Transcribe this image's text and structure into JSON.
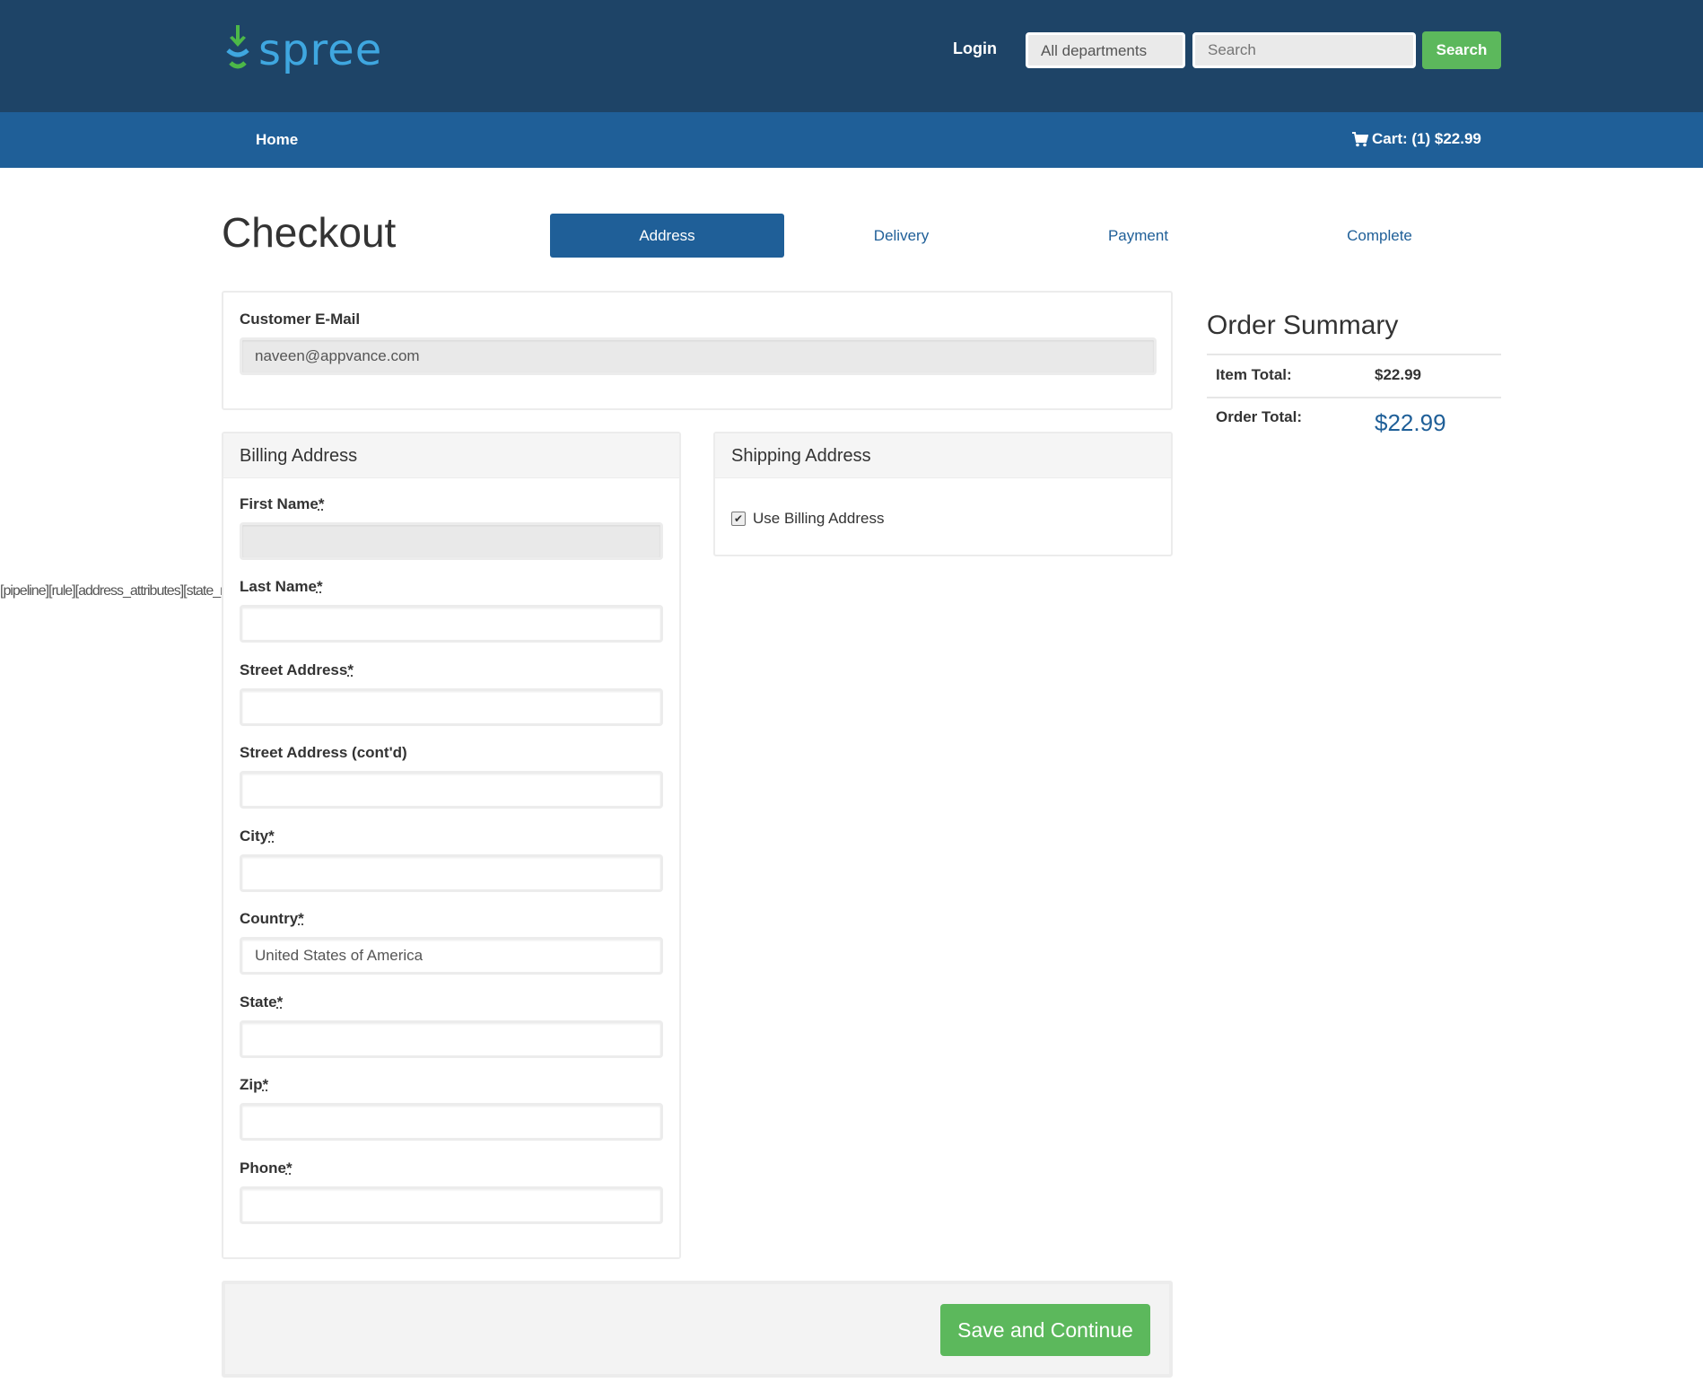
{
  "header": {
    "logo_text": "spree",
    "login_label": "Login",
    "department_value": "All departments",
    "search_placeholder": "Search",
    "search_button": "Search"
  },
  "nav": {
    "home": "Home",
    "cart": "Cart: (1) $22.99"
  },
  "checkout": {
    "title": "Checkout",
    "steps": [
      "Address",
      "Delivery",
      "Payment",
      "Complete"
    ],
    "active_step": "Address"
  },
  "email": {
    "label": "Customer E-Mail",
    "value": "naveen@appvance.com"
  },
  "billing": {
    "heading": "Billing Address",
    "fields": {
      "first_name": "First Name",
      "last_name": "Last Name",
      "street": "Street Address",
      "street2": "Street Address (cont'd)",
      "city": "City",
      "country": "Country",
      "state": "State",
      "zip": "Zip",
      "phone": "Phone"
    },
    "required_mark": "*",
    "country_value": "United States of America"
  },
  "overlay_text": "[pipeline][rule][address_attributes][state_name]\" /",
  "shipping": {
    "heading": "Shipping Address",
    "use_billing_label": "Use Billing Address",
    "use_billing_checked": true
  },
  "summary": {
    "title": "Order Summary",
    "item_total_label": "Item Total:",
    "item_total_value": "$22.99",
    "order_total_label": "Order Total:",
    "order_total_value": "$22.99"
  },
  "actions": {
    "save_label": "Save and Continue"
  },
  "colors": {
    "header_bg": "#1e4467",
    "nav_bg": "#1f5f98",
    "accent_green": "#5cb85c"
  }
}
